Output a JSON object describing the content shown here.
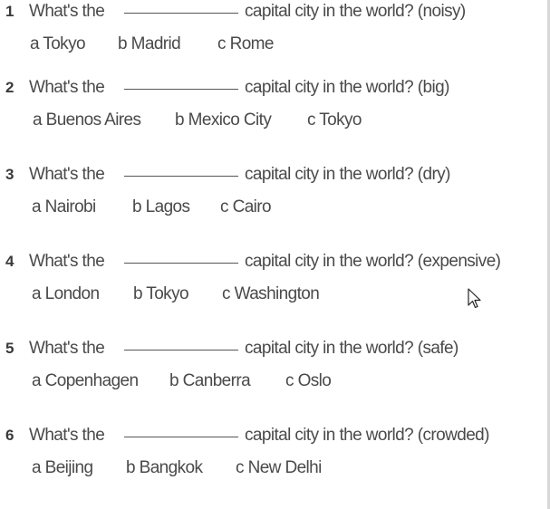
{
  "questions": [
    {
      "number": "1",
      "prefix": "What's the",
      "suffix": "capital city in the world? (noisy)",
      "options": [
        "a Tokyo",
        "b Madrid",
        "c Rome"
      ]
    },
    {
      "number": "2",
      "prefix": "What's the",
      "suffix": "capital city in the world? (big)",
      "options": [
        "a Buenos Aires",
        "b Mexico City",
        "c Tokyo"
      ]
    },
    {
      "number": "3",
      "prefix": "What's the",
      "suffix": "capital city in the world? (dry)",
      "options": [
        "a Nairobi",
        "b Lagos",
        "c Cairo"
      ]
    },
    {
      "number": "4",
      "prefix": "What's the",
      "suffix": "capital city in the world? (expensive)",
      "options": [
        "a London",
        "b Tokyo",
        "c Washington"
      ]
    },
    {
      "number": "5",
      "prefix": "What's the",
      "suffix": "capital city in the world? (safe)",
      "options": [
        "a Copenhagen",
        "b Canberra",
        "c Oslo"
      ]
    },
    {
      "number": "6",
      "prefix": "What's the",
      "suffix": "capital city in the world? (crowded)",
      "options": [
        "a Beijing",
        "b Bangkok",
        "c New Delhi"
      ]
    }
  ],
  "cursor": {
    "icon": "mouse-pointer-icon"
  }
}
